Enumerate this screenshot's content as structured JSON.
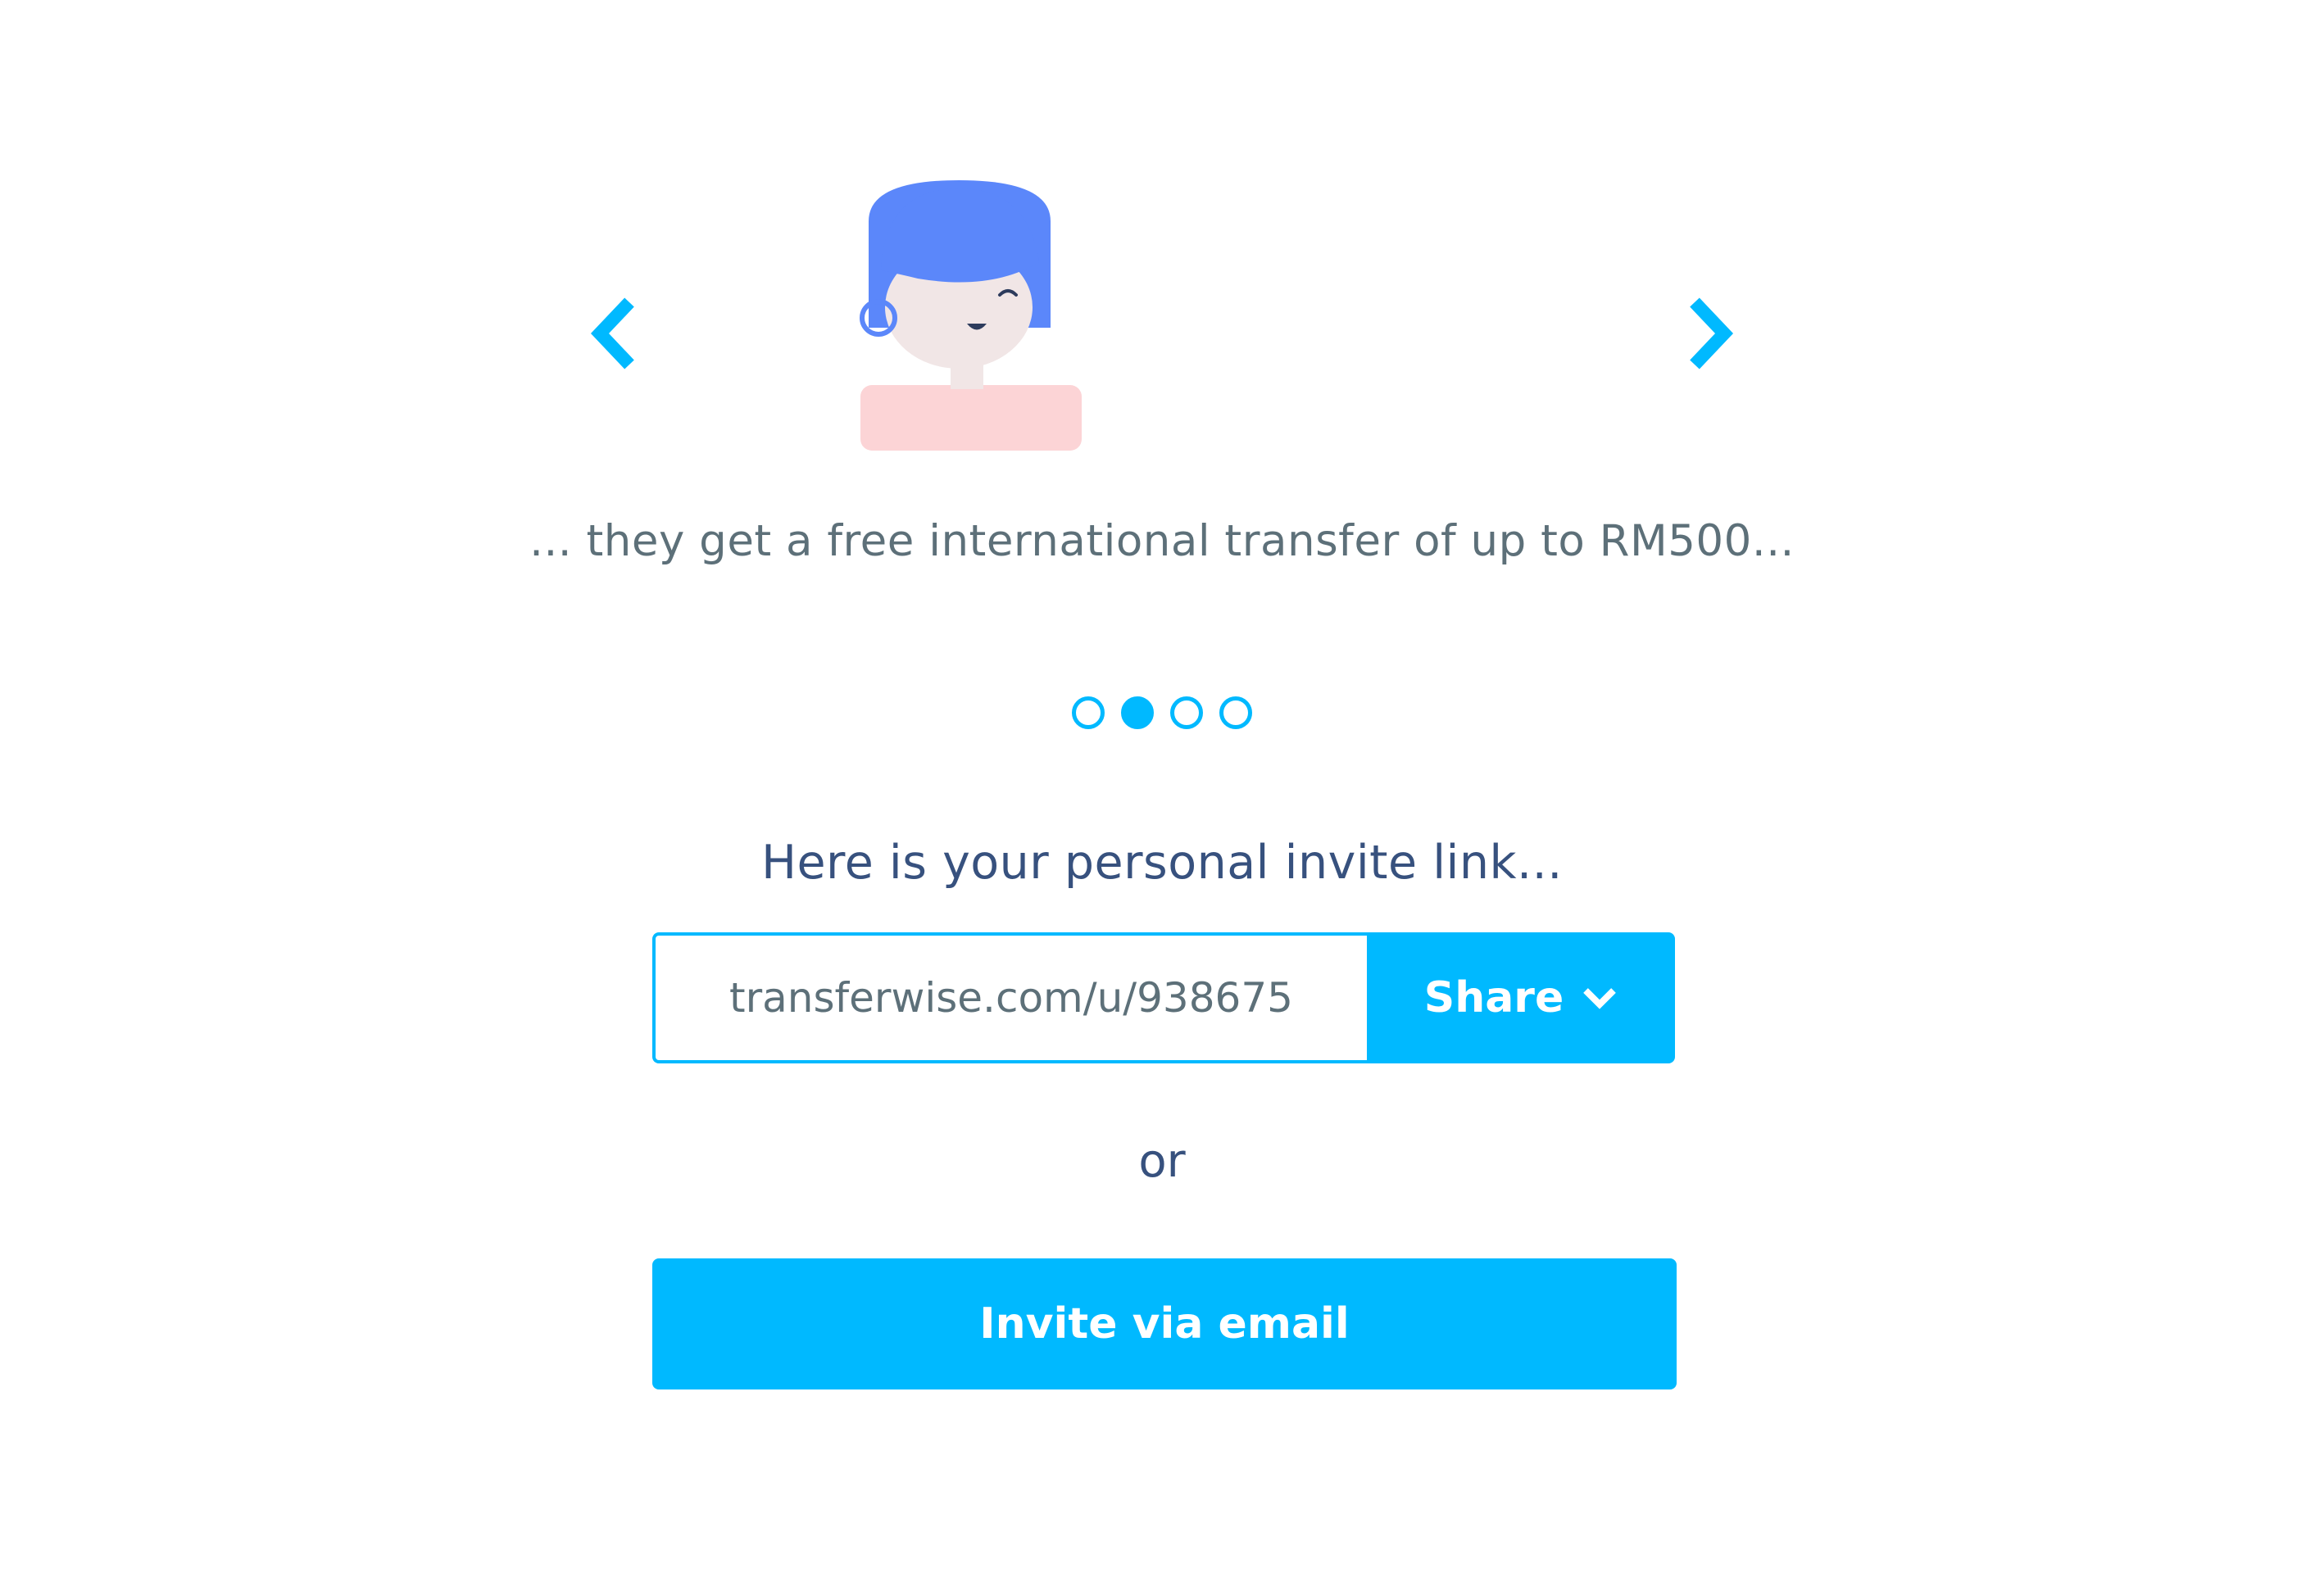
{
  "colors": {
    "accent": "#00b9ff",
    "heading_text": "#37517e",
    "body_text": "#5d7079",
    "hair": "#5b87fa",
    "skin": "#f1e6e6",
    "shirt": "#fcd4d6"
  },
  "carousel": {
    "prev_icon": "chevron-left-icon",
    "next_icon": "chevron-right-icon",
    "caption": "... they get a free international transfer of up to RM500...",
    "slide_count": 4,
    "active_slide_index": 1
  },
  "invite": {
    "heading": "Here is your personal invite link...",
    "link_value": "transferwise.com/u/938675",
    "share_label": "Share",
    "share_icon": "chevron-down-icon",
    "or_label": "or",
    "email_button_label": "Invite via email"
  }
}
